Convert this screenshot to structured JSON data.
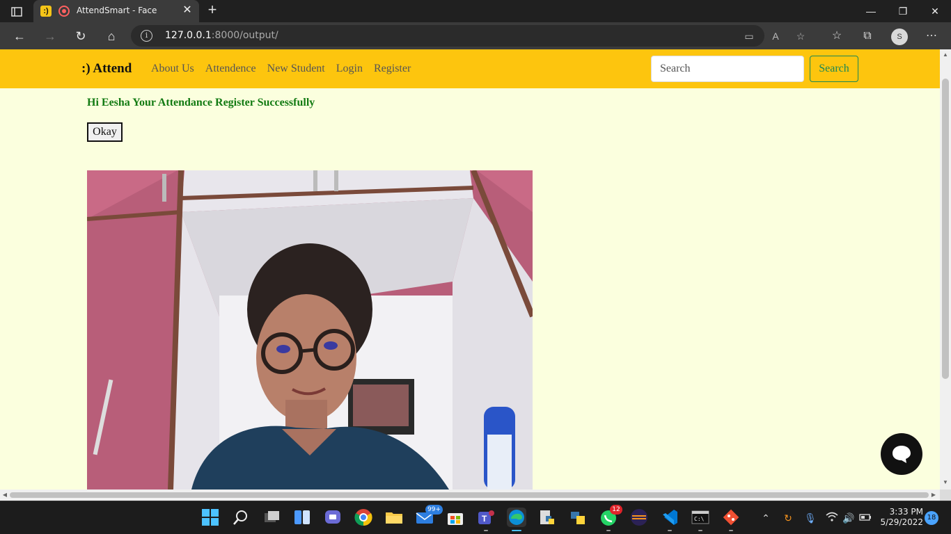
{
  "browser": {
    "tab_title": "AttendSmart - Face",
    "url_host": "127.0.0.1",
    "url_rest": ":8000/output/",
    "profile_initial": "S"
  },
  "page": {
    "brand": ":) Attend",
    "nav_links": [
      "About Us",
      "Attendence",
      "New Student",
      "Login",
      "Register"
    ],
    "search": {
      "placeholder": "Search",
      "button_label": "Search"
    },
    "message": "Hi Eesha Your Attendance Register Successfully",
    "okay_label": "Okay",
    "colors": {
      "navbar": "#fdc50e",
      "background": "#fbffde",
      "message": "#127a12",
      "search_button": "#198754"
    }
  },
  "taskbar": {
    "mail_badge": "99+",
    "whatsapp_badge": "12",
    "time": "3:33 PM",
    "date": "5/29/2022",
    "notifications": "18"
  }
}
